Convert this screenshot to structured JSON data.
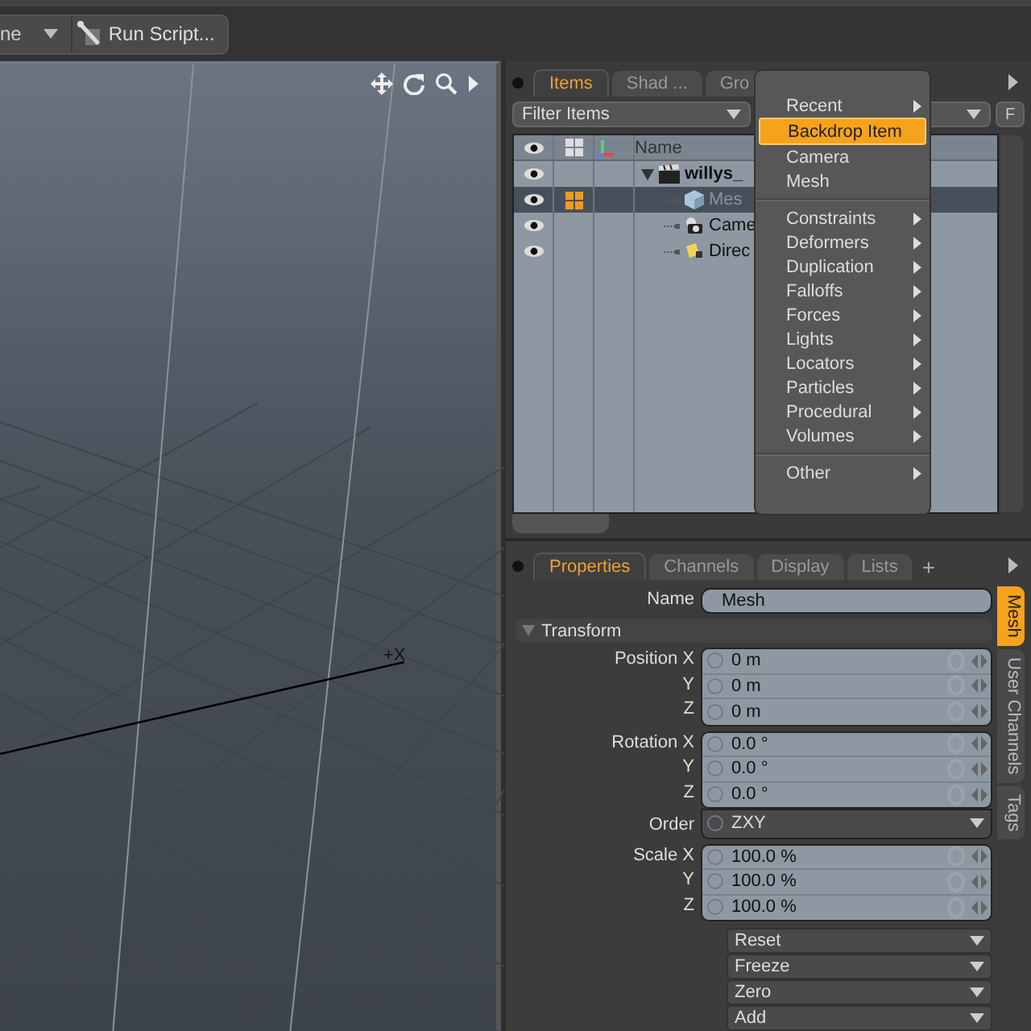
{
  "toolbar": {
    "partial_label": "ne",
    "run_script": "Run Script..."
  },
  "viewport": {
    "axis_label": "+X"
  },
  "items_panel": {
    "tabs": [
      {
        "label": "Items",
        "selected": true
      },
      {
        "label": "Shad ...",
        "selected": false
      },
      {
        "label": "Gro",
        "selected": false
      }
    ],
    "filter": {
      "value": "Filter Items"
    },
    "filter_button": "F",
    "name_column": "Name",
    "tree": [
      {
        "label": "willys_",
        "kind": "scene",
        "expanded": true,
        "selected": false,
        "children": [
          {
            "label": "Mes",
            "kind": "mesh",
            "selected": true
          },
          {
            "label": "Came",
            "kind": "camera",
            "selected": false
          },
          {
            "label": "Direc",
            "kind": "light",
            "selected": false
          }
        ]
      }
    ]
  },
  "context_menu": {
    "sections": [
      [
        {
          "label": "Recent",
          "submenu": true,
          "selected": false
        },
        {
          "label": "Backdrop Item",
          "submenu": false,
          "selected": true
        },
        {
          "label": "Camera",
          "submenu": false,
          "selected": false
        },
        {
          "label": "Mesh",
          "submenu": false,
          "selected": false
        }
      ],
      [
        {
          "label": "Constraints",
          "submenu": true,
          "selected": false
        },
        {
          "label": "Deformers",
          "submenu": true,
          "selected": false
        },
        {
          "label": "Duplication",
          "submenu": true,
          "selected": false
        },
        {
          "label": "Falloffs",
          "submenu": true,
          "selected": false
        },
        {
          "label": "Forces",
          "submenu": true,
          "selected": false
        },
        {
          "label": "Lights",
          "submenu": true,
          "selected": false
        },
        {
          "label": "Locators",
          "submenu": true,
          "selected": false
        },
        {
          "label": "Particles",
          "submenu": true,
          "selected": false
        },
        {
          "label": "Procedural",
          "submenu": true,
          "selected": false
        },
        {
          "label": "Volumes",
          "submenu": true,
          "selected": false
        }
      ],
      [
        {
          "label": "Other",
          "submenu": true,
          "selected": false
        }
      ]
    ]
  },
  "properties_panel": {
    "tabs": [
      {
        "label": "Properties",
        "selected": true
      },
      {
        "label": "Channels",
        "selected": false
      },
      {
        "label": "Display",
        "selected": false
      },
      {
        "label": "Lists",
        "selected": false
      }
    ],
    "add_tab": "+",
    "side_tabs": [
      {
        "label": "Mesh",
        "selected": true
      },
      {
        "label": "User Channels",
        "selected": false
      },
      {
        "label": "Tags",
        "selected": false
      }
    ],
    "name": {
      "label": "Name",
      "value": "Mesh"
    },
    "section": {
      "label": "Transform",
      "expanded": true
    },
    "groups": [
      {
        "kind": "numeric",
        "rows": [
          {
            "label": "Position X",
            "value": "0 m"
          },
          {
            "label": "Y",
            "value": "0 m"
          },
          {
            "label": "Z",
            "value": "0 m"
          }
        ]
      },
      {
        "kind": "numeric",
        "rows": [
          {
            "label": "Rotation X",
            "value": "0.0 °"
          },
          {
            "label": "Y",
            "value": "0.0 °"
          },
          {
            "label": "Z",
            "value": "0.0 °"
          }
        ]
      },
      {
        "kind": "dropdown",
        "rows": [
          {
            "label": "Order",
            "value": "ZXY"
          }
        ]
      },
      {
        "kind": "numeric",
        "rows": [
          {
            "label": "Scale X",
            "value": "100.0 %"
          },
          {
            "label": "Y",
            "value": "100.0 %"
          },
          {
            "label": "Z",
            "value": "100.0 %"
          }
        ]
      }
    ],
    "actions": [
      "Reset",
      "Freeze",
      "Zero",
      "Add"
    ]
  }
}
